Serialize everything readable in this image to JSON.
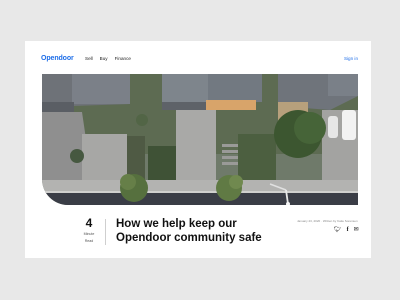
{
  "nav": {
    "logo": "Opendoor",
    "links": [
      "Sell",
      "Buy",
      "Finance"
    ],
    "signin": "Sign in"
  },
  "article": {
    "read_time_number": "4",
    "read_time_label_1": "Minute",
    "read_time_label_2": "Read",
    "title_line_1": "How we help keep our",
    "title_line_2": "Opendoor community safe",
    "meta": "January 23, 2020 · Written by Katie Sorensen"
  },
  "share": {
    "twitter_icon": "twitter-icon",
    "facebook_icon": "facebook-icon",
    "email_icon": "email-icon"
  },
  "colors": {
    "brand": "#1e6ee8",
    "background": "#e8e8e8"
  }
}
